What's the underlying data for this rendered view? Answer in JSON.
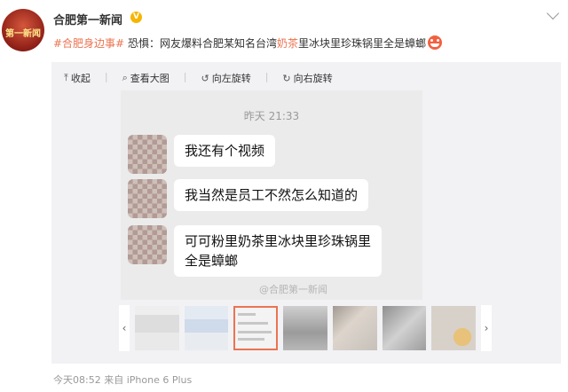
{
  "author": {
    "name": "合肥第一新闻",
    "avatar_text": "第一新闻",
    "verified_badge": "V"
  },
  "post": {
    "hashtag": "#合肥身边事#",
    "text_before": " 恐惧：网友爆料合肥某知名台湾",
    "text_highlight": "奶茶",
    "text_after": "里冰块里珍珠锅里全是蟑螂"
  },
  "toolbar": {
    "collapse": "收起",
    "view_large": "查看大图",
    "rotate_left": "向左旋转",
    "rotate_right": "向右旋转",
    "collapse_icon": "⤒",
    "view_icon": "⌕",
    "rotate_left_icon": "↺",
    "rotate_right_icon": "↻"
  },
  "chat": {
    "time": "昨天 21:33",
    "messages": [
      "我还有个视频",
      "我当然是员工不然怎么知道的",
      "可可粉里奶茶里冰块里珍珠锅里\n全是蟑螂"
    ]
  },
  "watermark": "@合肥第一新闻",
  "thumbnail_nav": {
    "prev": "‹",
    "next": "›"
  },
  "footer": {
    "time": "今天08:52",
    "source_prefix": "来自",
    "device": "iPhone 6 Plus"
  },
  "colors": {
    "accent": "#eb7350",
    "badge": "#f6b500"
  }
}
